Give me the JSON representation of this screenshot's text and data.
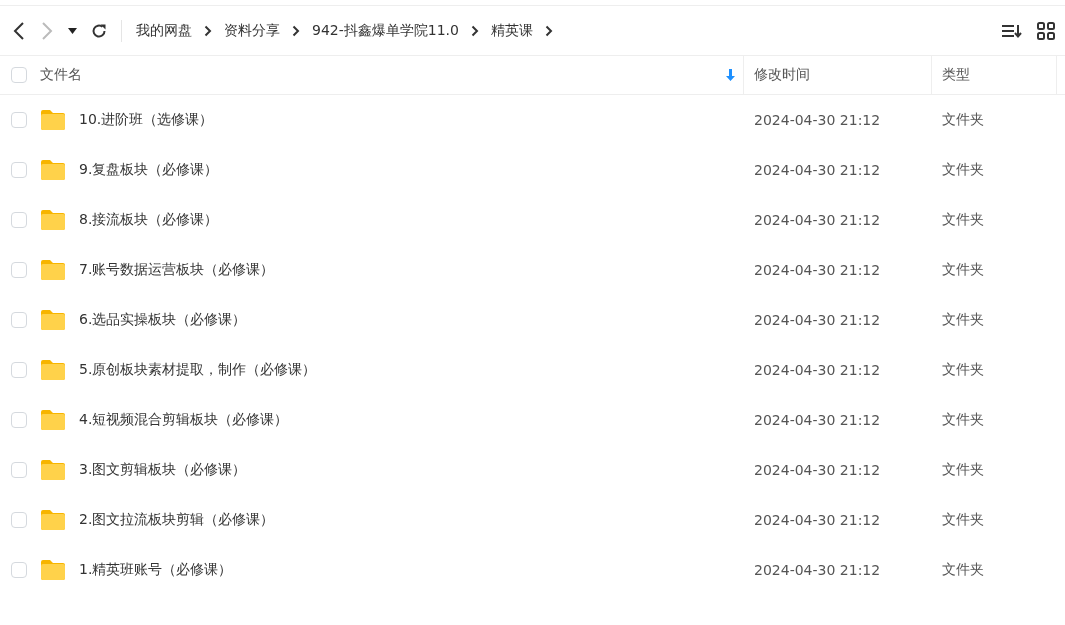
{
  "breadcrumb": [
    "我的网盘",
    "资料分享",
    "942-抖鑫爆单学院11.0",
    "精英课"
  ],
  "table": {
    "select_all": {
      "checked": false
    },
    "columns": [
      {
        "label": "文件名",
        "sorted": true
      },
      {
        "label": "修改时间",
        "sorted": false
      },
      {
        "label": "类型",
        "sorted": false
      }
    ],
    "rows": [
      {
        "name": "10.进阶班（选修课）",
        "modified": "2024-04-30 21:12",
        "type": "文件夹",
        "checked": false
      },
      {
        "name": "9.复盘板块（必修课）",
        "modified": "2024-04-30 21:12",
        "type": "文件夹",
        "checked": false
      },
      {
        "name": "8.接流板块（必修课）",
        "modified": "2024-04-30 21:12",
        "type": "文件夹",
        "checked": false
      },
      {
        "name": "7.账号数据运营板块（必修课）",
        "modified": "2024-04-30 21:12",
        "type": "文件夹",
        "checked": false
      },
      {
        "name": "6.选品实操板块（必修课）",
        "modified": "2024-04-30 21:12",
        "type": "文件夹",
        "checked": false
      },
      {
        "name": "5.原创板块素材提取，制作（必修课）",
        "modified": "2024-04-30 21:12",
        "type": "文件夹",
        "checked": false
      },
      {
        "name": "4.短视频混合剪辑板块（必修课）",
        "modified": "2024-04-30 21:12",
        "type": "文件夹",
        "checked": false
      },
      {
        "name": "3.图文剪辑板块（必修课）",
        "modified": "2024-04-30 21:12",
        "type": "文件夹",
        "checked": false
      },
      {
        "name": "2.图文拉流板块剪辑（必修课）",
        "modified": "2024-04-30 21:12",
        "type": "文件夹",
        "checked": false
      },
      {
        "name": "1.精英班账号（必修课）",
        "modified": "2024-04-30 21:12",
        "type": "文件夹",
        "checked": false
      }
    ]
  }
}
